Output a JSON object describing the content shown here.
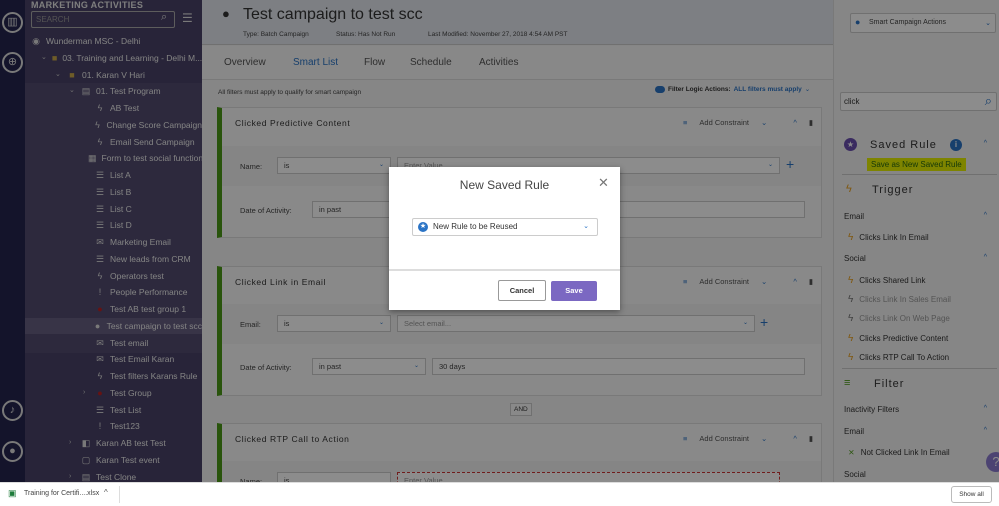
{
  "rail": {
    "icons": [
      "marketo-logo-icon",
      "globe-icon",
      "bell-icon",
      "user-icon"
    ]
  },
  "tree": {
    "header": "MARKETING ACTIVITIES",
    "search_placeholder": "SEARCH",
    "items": [
      {
        "label": "Wunderman MSC - Delhi",
        "icon": "workspace-icon",
        "level": 0
      },
      {
        "label": "03. Training and Learning - Delhi M...",
        "icon": "folder-icon",
        "level": 1,
        "chevron": "down"
      },
      {
        "label": "01. Karan V Hari",
        "icon": "folder-icon",
        "level": 2,
        "chevron": "down"
      },
      {
        "label": "01. Test Program",
        "icon": "program-icon",
        "level": 3,
        "chevron": "down"
      },
      {
        "label": "AB Test",
        "icon": "bolt-icon",
        "level": 4
      },
      {
        "label": "Change Score Campaign",
        "icon": "bolt-icon",
        "level": 4
      },
      {
        "label": "Email Send Campaign",
        "icon": "bolt-icon",
        "level": 4
      },
      {
        "label": "Form to test social functions",
        "icon": "form-icon",
        "level": 4
      },
      {
        "label": "List A",
        "icon": "list-icon",
        "level": 4
      },
      {
        "label": "List B",
        "icon": "list-icon",
        "level": 4
      },
      {
        "label": "List C",
        "icon": "list-icon",
        "level": 4
      },
      {
        "label": "List D",
        "icon": "list-icon",
        "level": 4
      },
      {
        "label": "Marketing Email",
        "icon": "email-icon",
        "level": 4
      },
      {
        "label": "New leads from CRM",
        "icon": "list-icon",
        "level": 4
      },
      {
        "label": "Operators test",
        "icon": "bolt-icon",
        "level": 4
      },
      {
        "label": "People Performance",
        "icon": "report-icon",
        "level": 4
      },
      {
        "label": "Test AB test group 1",
        "icon": "test-group-icon",
        "level": 4
      },
      {
        "label": "Test campaign to test scc",
        "icon": "lightbulb-icon",
        "level": 4,
        "selected": true
      },
      {
        "label": "Test email",
        "icon": "email-icon",
        "level": 4
      },
      {
        "label": "Test Email Karan",
        "icon": "email-icon",
        "level": 4
      },
      {
        "label": "Test filters Karans Rule",
        "icon": "bolt-icon",
        "level": 4
      },
      {
        "label": "Test Group",
        "icon": "test-group-icon",
        "level": 4,
        "chevron": "right"
      },
      {
        "label": "Test List",
        "icon": "list-icon",
        "level": 4
      },
      {
        "label": "Test123",
        "icon": "report-icon",
        "level": 4
      },
      {
        "label": "Karan AB test Test",
        "icon": "ab-test-icon",
        "level": 3,
        "chevron": "right"
      },
      {
        "label": "Karan Test event",
        "icon": "calendar-icon",
        "level": 3
      },
      {
        "label": "Test Clone",
        "icon": "program-icon",
        "level": 3,
        "chevron": "right"
      }
    ]
  },
  "header": {
    "title": "Test campaign to test scc",
    "type": "Type: Batch Campaign",
    "status": "Status: Has Not Run",
    "modified": "Last Modified: November 27, 2018 4:54 AM PST",
    "actions_label": "Smart Campaign Actions"
  },
  "tabs": [
    "Overview",
    "Smart List",
    "Flow",
    "Schedule",
    "Activities"
  ],
  "active_tab": "Smart List",
  "smartlist": {
    "note": "All filters must apply to qualify for smart campaign",
    "logic_label": "Filter Logic Actions:",
    "logic_value": "ALL filters must apply",
    "add_constraint": "Add Constraint",
    "and_label": "AND",
    "cards": [
      {
        "title": "Clicked Predictive Content",
        "rows": [
          {
            "label": "Name:",
            "op": "is",
            "value": "",
            "placeholder": "Enter Value..."
          },
          {
            "label": "Date of Activity:",
            "op": "in past",
            "value": "",
            "placeholder": ""
          }
        ]
      },
      {
        "title": "Clicked Link in Email",
        "rows": [
          {
            "label": "Email:",
            "op": "is",
            "value": "",
            "placeholder": "Select email..."
          },
          {
            "label": "Date of Activity:",
            "op": "in past",
            "value": "30 days",
            "placeholder": ""
          }
        ]
      },
      {
        "title": "Clicked RTP Call to Action",
        "rows": [
          {
            "label": "Name:",
            "op": "is",
            "value": "",
            "placeholder": "Enter Value..."
          }
        ]
      }
    ]
  },
  "right": {
    "search_value": "click",
    "saved_rule": "Saved Rule",
    "save_new": "Save as New Saved Rule",
    "trigger": "Trigger",
    "email_group": "Email",
    "social_group": "Social",
    "triggers_email": [
      "Clicks Link In Email"
    ],
    "triggers_social": [
      {
        "label": "Clicks Shared Link",
        "enabled": true
      },
      {
        "label": "Clicks Link In Sales Email",
        "enabled": false
      },
      {
        "label": "Clicks Link On Web Page",
        "enabled": false
      },
      {
        "label": "Clicks Predictive Content",
        "enabled": true
      },
      {
        "label": "Clicks RTP Call To Action",
        "enabled": true
      }
    ],
    "filter": "Filter",
    "inactivity": "Inactivity Filters",
    "filter_email": "Email",
    "filter_item": "Not Clicked Link In Email",
    "filter_social": "Social",
    "help": "?"
  },
  "modal": {
    "title": "New Saved Rule",
    "input_value": "New Rule to be Reused",
    "cancel": "Cancel",
    "save": "Save"
  },
  "download": {
    "file": "Training for Certifi....xlsx",
    "show_all": "Show all"
  },
  "colors": {
    "accent": "#2a73c5",
    "save_button": "#7b68c2",
    "highlight": "#e5f000",
    "card_border": "#4c9a16",
    "bolt": "#e8a020"
  }
}
